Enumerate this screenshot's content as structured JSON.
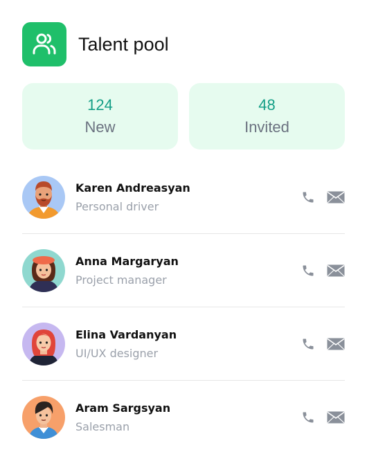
{
  "header": {
    "title": "Talent pool",
    "icon": "users-icon",
    "accent": "#1fbf6a"
  },
  "stats": [
    {
      "count": "124",
      "label": "New"
    },
    {
      "count": "48",
      "label": "Invited"
    }
  ],
  "colors": {
    "stat_bg": "#e6fbef",
    "stat_count": "#139e86",
    "stat_label": "#6b7280",
    "muted": "#9aa0aa"
  },
  "candidates": [
    {
      "name": "Karen Andreasyan",
      "role": "Personal driver",
      "actions": [
        "phone-icon",
        "mail-icon"
      ]
    },
    {
      "name": "Anna Margaryan",
      "role": "Project manager",
      "actions": [
        "phone-icon",
        "mail-icon"
      ]
    },
    {
      "name": "Elina Vardanyan",
      "role": "UI/UX designer",
      "actions": [
        "phone-icon",
        "mail-icon"
      ]
    },
    {
      "name": "Aram Sargsyan",
      "role": "Salesman",
      "actions": [
        "phone-icon",
        "mail-icon"
      ]
    }
  ]
}
